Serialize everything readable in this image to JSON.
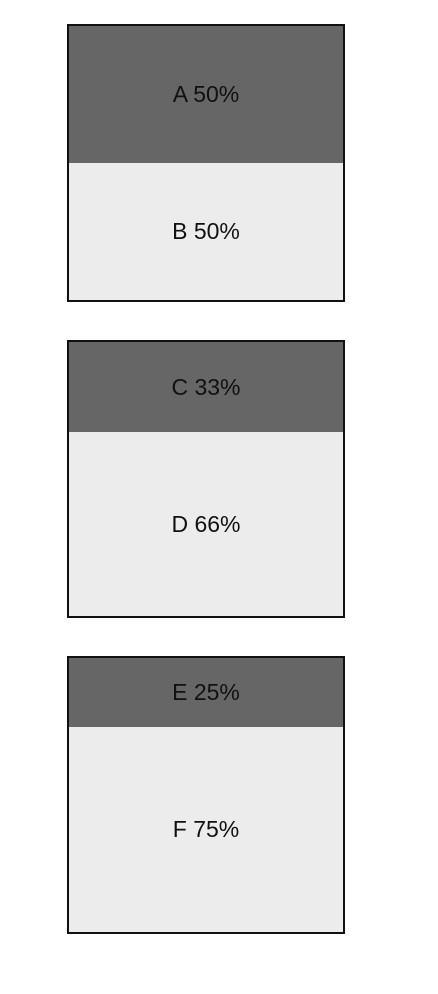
{
  "colors": {
    "top_fill": "#666666",
    "bottom_fill": "#ececec",
    "border": "#111111",
    "text": "#111111"
  },
  "boxes": [
    {
      "top": {
        "label": "A 50%",
        "fraction": 0.5
      },
      "bottom": {
        "label": "B 50%",
        "fraction": 0.5
      }
    },
    {
      "top": {
        "label": "C 33%",
        "fraction": 0.33
      },
      "bottom": {
        "label": "D 66%",
        "fraction": 0.67
      }
    },
    {
      "top": {
        "label": "E 25%",
        "fraction": 0.25
      },
      "bottom": {
        "label": "F 75%",
        "fraction": 0.75
      }
    }
  ]
}
